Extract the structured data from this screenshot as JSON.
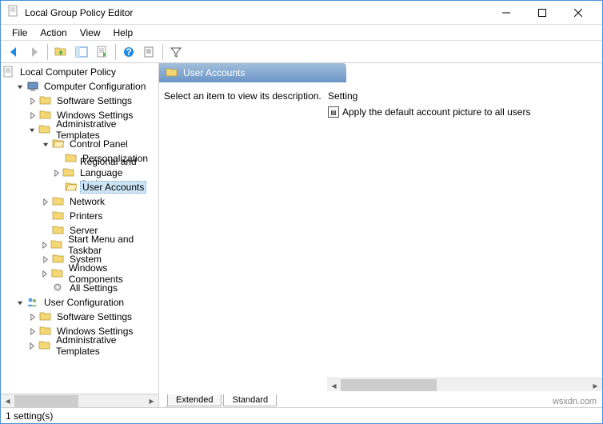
{
  "window": {
    "title": "Local Group Policy Editor"
  },
  "menu": {
    "file": "File",
    "action": "Action",
    "view": "View",
    "help": "Help"
  },
  "tree": {
    "root": "Local Computer Policy",
    "computer_config": "Computer Configuration",
    "cc_software": "Software Settings",
    "cc_windows": "Windows Settings",
    "cc_admin": "Administrative Templates",
    "control_panel": "Control Panel",
    "personalization": "Personalization",
    "regional": "Regional and Language Options",
    "user_accounts": "User Accounts",
    "network": "Network",
    "printers": "Printers",
    "server": "Server",
    "startmenu": "Start Menu and Taskbar",
    "system": "System",
    "windows_components": "Windows Components",
    "all_settings": "All Settings",
    "user_config": "User Configuration",
    "uc_software": "Software Settings",
    "uc_windows": "Windows Settings",
    "uc_admin": "Administrative Templates"
  },
  "content": {
    "header": "User Accounts",
    "description_prompt": "Select an item to view its description.",
    "column_setting": "Setting",
    "setting1": "Apply the default account picture to all users"
  },
  "tabs": {
    "extended": "Extended",
    "standard": "Standard"
  },
  "status": {
    "text": "1 setting(s)"
  },
  "watermark": "wsxdn.com"
}
